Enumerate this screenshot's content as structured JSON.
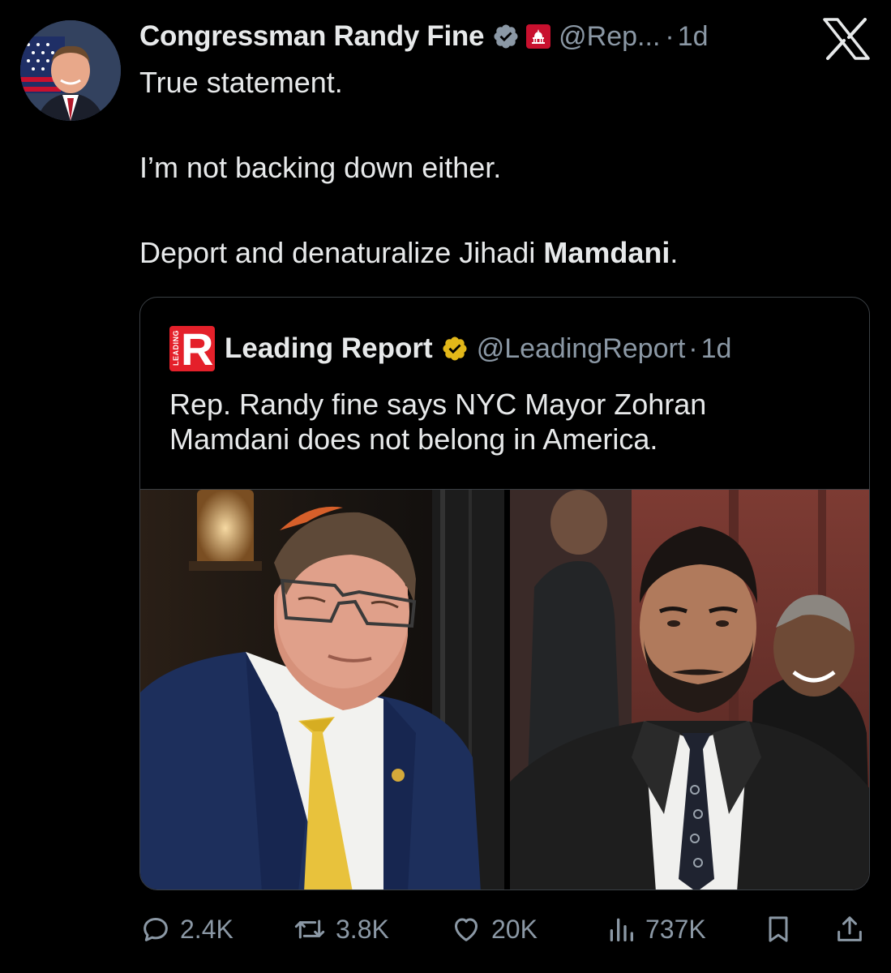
{
  "author": {
    "display_name": "Congressman Randy Fine",
    "handle": "@Rep...",
    "separator": "·",
    "time": "1d"
  },
  "tweet": {
    "lines": [
      "True statement.",
      "I’m not backing down either.",
      "Deport and denaturalize Jihadi "
    ],
    "bold_word": "Mamdani",
    "end_punct": "."
  },
  "quoted": {
    "logo_letter": "R",
    "logo_side_text": "LEADING",
    "display_name": "Leading Report",
    "handle": "@LeadingReport",
    "separator": "·",
    "time": "1d",
    "text": "Rep. Randy fine says NYC Mayor Zohran Mamdani does not belong in America."
  },
  "actions": {
    "replies": "2.4K",
    "reposts": "3.8K",
    "likes": "20K",
    "views": "737K"
  },
  "colors": {
    "background": "#000000",
    "text": "#e7e9ea",
    "muted": "#8b98a5",
    "verified_blue": "#1d9bf0",
    "verified_gold": "#e2b719",
    "gov_badge": "#c8102e",
    "logo_red": "#e4202a"
  },
  "icons": [
    "verified-badge-icon",
    "government-badge-icon",
    "x-logo-icon",
    "reply-icon",
    "repost-icon",
    "like-icon",
    "views-icon",
    "bookmark-icon",
    "share-icon"
  ]
}
